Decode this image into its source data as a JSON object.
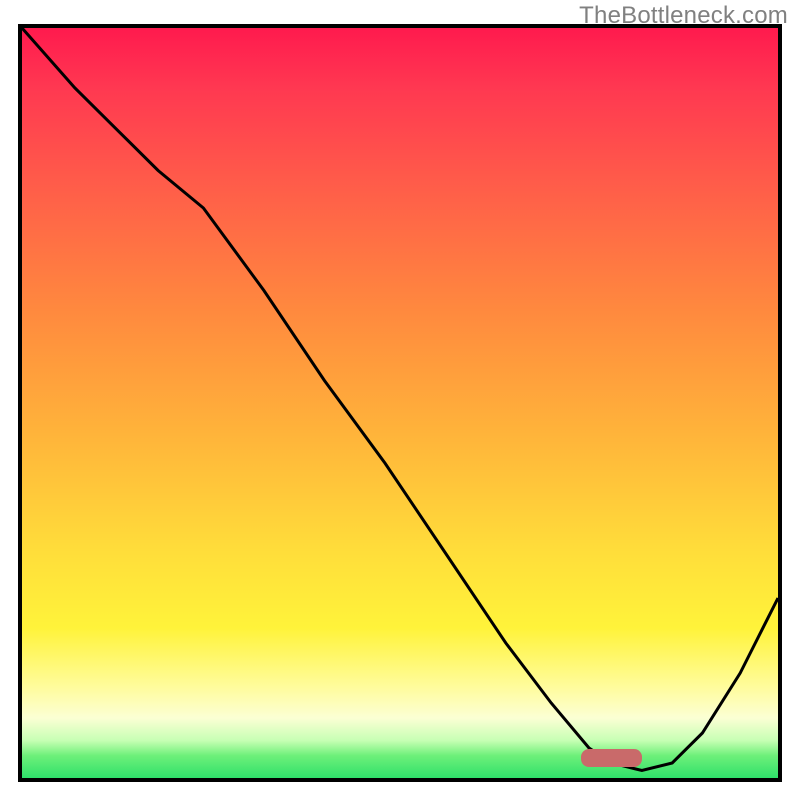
{
  "watermark": {
    "text": "TheBottleneck.com"
  },
  "colors": {
    "curve": "#000000",
    "marker": "#c96a6a",
    "border": "#000000",
    "gradient_top": "#ff1a4e",
    "gradient_bottom": "#2fe06a"
  },
  "plot": {
    "inner_width": 756,
    "inner_height": 750
  },
  "chart_data": {
    "type": "line",
    "title": "",
    "xlabel": "",
    "ylabel": "",
    "xlim": [
      0,
      100
    ],
    "ylim": [
      0,
      100
    ],
    "grid": false,
    "legend": false,
    "series": [
      {
        "name": "curve",
        "x": [
          0,
          7,
          18,
          24,
          32,
          40,
          48,
          56,
          64,
          70,
          75,
          78,
          82,
          86,
          90,
          95,
          100
        ],
        "y": [
          100,
          92,
          81,
          76,
          65,
          53,
          42,
          30,
          18,
          10,
          4,
          2,
          1,
          2,
          6,
          14,
          24
        ]
      }
    ],
    "marker": {
      "x_start": 74,
      "x_end": 82,
      "y": 1.5,
      "height": 2.4
    },
    "gradient_stops": [
      {
        "pos": 0.0,
        "color": "#ff1a4e"
      },
      {
        "pos": 0.2,
        "color": "#ff5a4a"
      },
      {
        "pos": 0.55,
        "color": "#ffb63a"
      },
      {
        "pos": 0.8,
        "color": "#fff33a"
      },
      {
        "pos": 0.92,
        "color": "#fbffd4"
      },
      {
        "pos": 1.0,
        "color": "#2fe06a"
      }
    ]
  }
}
